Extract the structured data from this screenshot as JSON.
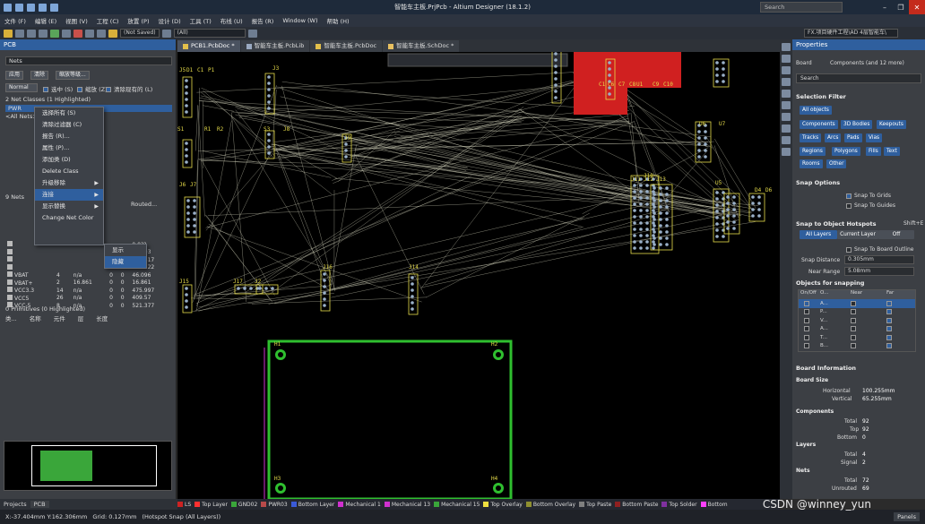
{
  "window": {
    "title": "智能车主板.PrjPcb - Altium Designer (18.1.2)",
    "search_placeholder": "Search"
  },
  "menu": [
    "文件 (F)",
    "编辑 (E)",
    "视图 (V)",
    "工程 (C)",
    "放置 (P)",
    "设计 (D)",
    "工具 (T)",
    "布线 (U)",
    "报告 (R)",
    "Window (W)",
    "帮助 (H)"
  ],
  "toolbar": {
    "not_saved": "(Not Saved)",
    "filter": "(All)",
    "workspace": "FX.项目硬件工程\\AD 4层智能车\\"
  },
  "doc_tabs": [
    "PCB1.PcbDoc *",
    "智能车主板.PcbLib",
    "智能车主板.PcbDoc",
    "智能车主板.SchDoc *"
  ],
  "left_panel": {
    "title": "PCB",
    "category": "Nets",
    "apply": "应用",
    "clear": "清除",
    "zoom_level": "缩放等级...",
    "mode": "Normal",
    "select_label": "选中 (S)",
    "zoom_label": "缩放 (Z)",
    "clear_existing": "清除现有的 (L)",
    "net_classes_header": "2 Net Classes (1 Highlighted)",
    "net_class_1": "PWR",
    "net_class_2": "<All Nets>",
    "nets_header_prefix": "9 Nets",
    "routed_header": "Routed...",
    "primitives_header": "0 Primitives (0 Highlighted)",
    "prim_cols": [
      "类...",
      "名称",
      "元件",
      "层",
      "长度"
    ],
    "context_menu": [
      "选择所有 (S)",
      "清除过滤器 (C)",
      "报告 (R)...",
      "属性 (P)...",
      "添加类 (D)",
      "Delete Class",
      "升级移除",
      "连接",
      "显示替换",
      "Change Net Color"
    ],
    "submenu": [
      "显示",
      "隐藏"
    ],
    "nets": [
      {
        "name": "",
        "count": "",
        "len": "",
        "a": "",
        "b": "",
        "routed": "0.0??"
      },
      {
        "name": "",
        "count": "",
        "len": "",
        "a": "",
        "b": "",
        "routed": "18.203"
      },
      {
        "name": "",
        "count": "",
        "len": "",
        "a": "",
        "b": "",
        "routed": "188.817"
      },
      {
        "name": "",
        "count": "",
        "len": "",
        "a": "",
        "b": "",
        "routed": "361.722"
      },
      {
        "name": "VBAT",
        "count": "4",
        "len": "n/a",
        "a": "0",
        "b": "0",
        "routed": "46.096"
      },
      {
        "name": "VBAT+",
        "count": "2",
        "len": "16.861",
        "a": "0",
        "b": "0",
        "routed": "16.861"
      },
      {
        "name": "VCC3.3",
        "count": "14",
        "len": "n/a",
        "a": "0",
        "b": "0",
        "routed": "475.997"
      },
      {
        "name": "VCC5",
        "count": "26",
        "len": "n/a",
        "a": "0",
        "b": "0",
        "routed": "409.57"
      },
      {
        "name": "VCC-5",
        "count": "8",
        "len": "n/a",
        "a": "0",
        "b": "0",
        "routed": "521.377"
      }
    ],
    "bottom_tabs": [
      "Projects",
      "PCB"
    ]
  },
  "right_panel": {
    "title": "Properties",
    "board_label": "Board",
    "components_filter": "Components (and 12 more)",
    "search_placeholder": "Search",
    "selection_filter": "Selection Filter",
    "all_objects": "All objects",
    "filters": [
      "Components",
      "3D Bodies",
      "Keepouts",
      "Tracks",
      "Arcs",
      "Pads",
      "Vias",
      "Regions",
      "Polygons",
      "Fills",
      "Text",
      "Rooms",
      "Other"
    ],
    "snap_options": "Snap Options",
    "snap_grids": "Snap To Grids",
    "snap_guides": "Snap To Guides",
    "hotspots": "Snap to Object Hotspots",
    "hotspot_key": "Shift+E",
    "layer_modes": [
      "All Layers",
      "Current Layer",
      "Off"
    ],
    "snap_outline": "Snap To Board Outline",
    "snap_distance_label": "Snap Distance",
    "snap_distance": "0.305mm",
    "near_range_label": "Near Range",
    "near_range": "5.08mm",
    "objects_for_snapping": "Objects for snapping",
    "snap_cols": [
      "On/Off",
      "O...",
      "Near",
      "Far"
    ],
    "snap_rows": [
      "A...",
      "P...",
      "V...",
      "A...",
      "T...",
      "B..."
    ],
    "board_info": "Board Information",
    "board_size": "Board Size",
    "horizontal_label": "Horizontal",
    "horizontal": "100.255mm",
    "vertical_label": "Vertical",
    "vertical": "65.255mm",
    "components_label": "Components",
    "comp_total_label": "Total",
    "comp_total": "92",
    "comp_top_label": "Top",
    "comp_top": "92",
    "comp_bottom_label": "Bottom",
    "comp_bottom": "0",
    "layers_label": "Layers",
    "layers_total_label": "Total",
    "layers_total": "4",
    "layers_signal_label": "Signal",
    "layers_signal": "2",
    "nets_label": "Nets",
    "nets_total_label": "Total",
    "nets_total": "72",
    "nets_unrouted_label": "Unrouted",
    "nets_unrouted": "69"
  },
  "layers": [
    {
      "name": "LS",
      "color": "#cc2222"
    },
    {
      "name": "Top Layer",
      "color": "#ff3030"
    },
    {
      "name": "GND02",
      "color": "#3aa63a"
    },
    {
      "name": "PWR03",
      "color": "#b84a4a"
    },
    {
      "name": "Bottom Layer",
      "color": "#3a5ad8"
    },
    {
      "name": "Mechanical 1",
      "color": "#d030d0"
    },
    {
      "name": "Mechanical 13",
      "color": "#d030d0"
    },
    {
      "name": "Mechanical 15",
      "color": "#3aa63a"
    },
    {
      "name": "Top Overlay",
      "color": "#f0e040"
    },
    {
      "name": "Bottom Overlay",
      "color": "#909030"
    },
    {
      "name": "Top Paste",
      "color": "#808080"
    },
    {
      "name": "Bottom Paste",
      "color": "#902020"
    },
    {
      "name": "Top Solder",
      "color": "#8030a0"
    },
    {
      "name": "Bottom",
      "color": "#ff40ff"
    }
  ],
  "status": {
    "coords": "X:-37.404mm Y:162.306mm",
    "grid": "Grid: 0.127mm",
    "hotspot": "(Hotspot Snap (All Layers))",
    "panels": "Panels"
  },
  "watermark": "CSDN @winney_yun",
  "pcb_labels": [
    "J5",
    "D1",
    "C1",
    "P1",
    "J3",
    "S1",
    "R1",
    "R2",
    "S3",
    "J8",
    "J9",
    "J6",
    "J7",
    "J10",
    "J15",
    "J17",
    "J2",
    "J16",
    "J14",
    "J11",
    "J12",
    "J13",
    "U6",
    "U7",
    "U5",
    "D4",
    "D6",
    "H1",
    "H2",
    "H3",
    "H4",
    "U1",
    "C1",
    "C6",
    "C7",
    "C8",
    "C9",
    "C10"
  ]
}
